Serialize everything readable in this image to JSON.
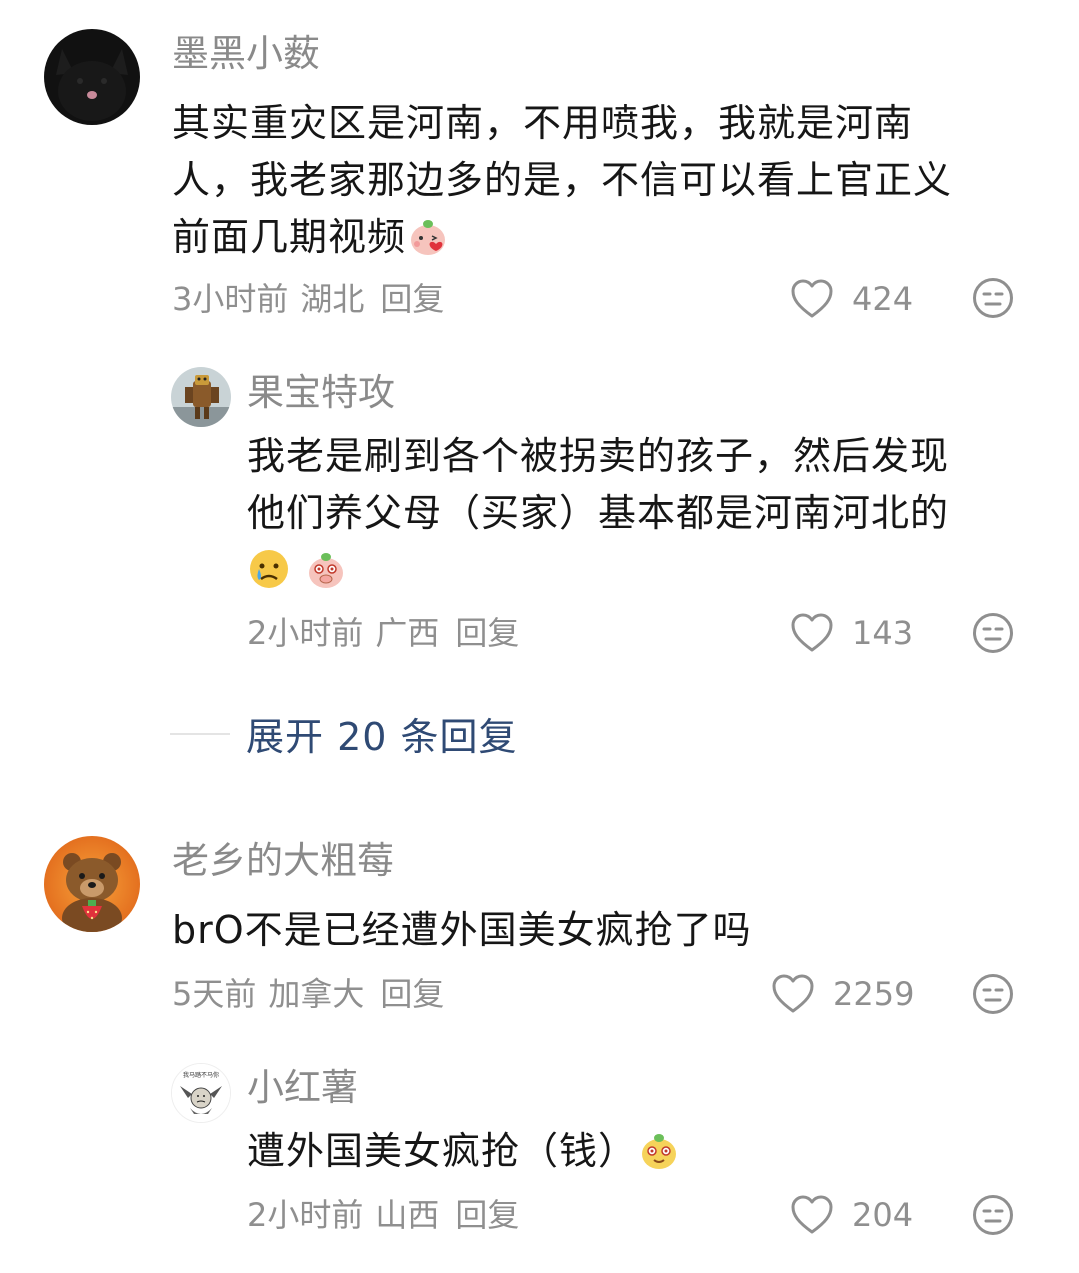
{
  "comments": [
    {
      "username": "墨黑小薮",
      "text_lines": [
        "其实重灾区是河南，不用喷我，我就是河南",
        "人，我老家那边多的是，不信可以看上官正义",
        "前面几期视频"
      ],
      "emoji_after": "kissing-peach-emoji",
      "time": "3小时前",
      "location": "湖北",
      "reply_label": "回复",
      "likes": "424",
      "avatar_icon": "black-cat-avatar",
      "reply": {
        "username": "果宝特攻",
        "text_lines": [
          "我老是刷到各个被拐卖的孩子，然后发现",
          "他们养父母（买家）基本都是河南河北的"
        ],
        "emojis": [
          "crying-face-emoji",
          "shocked-peach-emoji"
        ],
        "time": "2小时前",
        "location": "广西",
        "reply_label": "回复",
        "likes": "143",
        "avatar_icon": "robot-figure-avatar"
      }
    },
    {
      "username": "老乡的大粗莓",
      "text_lines": [
        "brO不是已经遭外国美女疯抢了吗"
      ],
      "time": "5天前",
      "location": "加拿大",
      "reply_label": "回复",
      "likes": "2259",
      "avatar_icon": "bear-strawberry-avatar",
      "reply": {
        "username": "小红薯",
        "text_lines": [
          "遭外国美女疯抢（钱）"
        ],
        "emojis": [
          "yellow-peach-smile-emoji"
        ],
        "time": "2小时前",
        "location": "山西",
        "reply_label": "回复",
        "likes": "204",
        "avatar_icon": "meme-sticker-avatar",
        "avatar_caption": "我马踏不马你"
      }
    }
  ],
  "expand_replies": "展开 20 条回复",
  "colors": {
    "username": "#8a8a8a",
    "text": "#161616",
    "meta": "#8f8f8f",
    "expand_link": "#2f4a74"
  }
}
